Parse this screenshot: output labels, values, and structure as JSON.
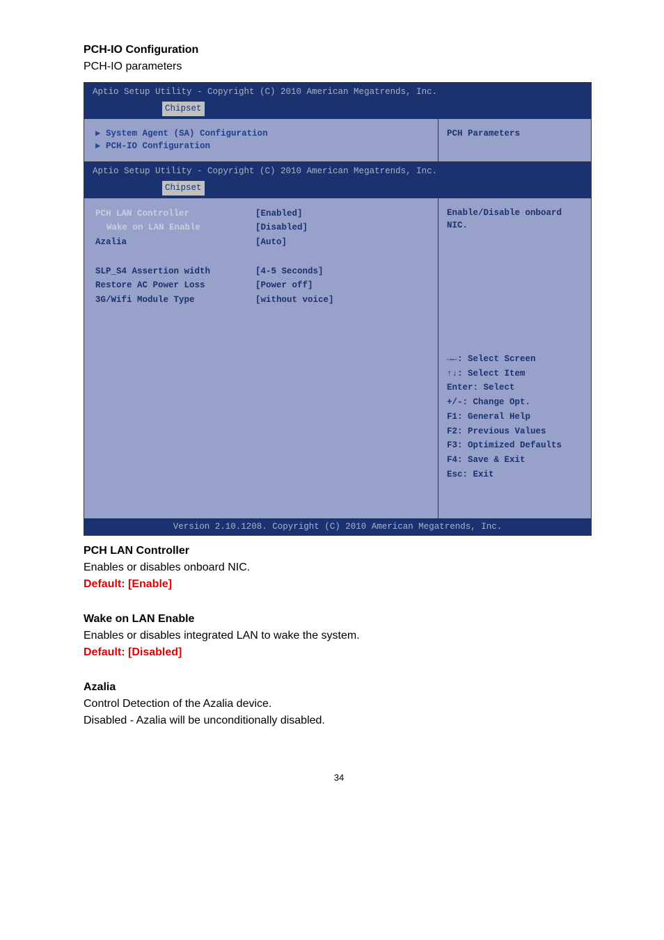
{
  "heading": "PCH-IO Configuration",
  "heading_sub": "PCH-IO parameters",
  "bios1": {
    "header_title": "Aptio Setup Utility - Copyright (C) 2010 American Megatrends, Inc.",
    "tab": "Chipset",
    "left_items": [
      "System Agent (SA) Configuration",
      "PCH-IO Configuration"
    ],
    "right_help": "PCH Parameters"
  },
  "bios2": {
    "header_title": "Aptio Setup Utility - Copyright (C) 2010 American Megatrends, Inc.",
    "tab": "Chipset",
    "settings": [
      {
        "label": "PCH LAN Controller",
        "value": "[Enabled]",
        "label_class": "label-white"
      },
      {
        "label": "Wake on LAN Enable",
        "value": "[Disabled]",
        "label_class": "label-white",
        "indent": true
      },
      {
        "label": "Azalia",
        "value": "[Auto]",
        "label_class": "label-blue"
      },
      {
        "label": "",
        "value": ""
      },
      {
        "label": "SLP_S4 Assertion width",
        "value": "[4-5 Seconds]",
        "label_class": "label-blue"
      },
      {
        "label": "Restore AC Power Loss",
        "value": "[Power off]",
        "label_class": "label-blue"
      },
      {
        "label": "3G/Wifi Module Type",
        "value": "[without voice]",
        "label_class": "label-blue"
      }
    ],
    "right_help_top": "Enable/Disable onboard NIC.",
    "right_help_bottom": [
      "→←: Select Screen",
      "↑↓: Select Item",
      "Enter: Select",
      "+/-: Change Opt.",
      "F1: General Help",
      "F2: Previous Values",
      "F3: Optimized Defaults",
      "F4: Save & Exit",
      "Esc: Exit"
    ],
    "footer": "Version 2.10.1208. Copyright (C) 2010 American Megatrends, Inc."
  },
  "sec1": {
    "title": "PCH LAN Controller",
    "desc": "Enables or disables onboard NIC.",
    "default": "Default: [Enable]"
  },
  "sec2": {
    "title": "Wake on LAN Enable",
    "desc": "Enables or disables integrated LAN to wake the system.",
    "default": "Default: [Disabled]"
  },
  "sec3": {
    "title": "Azalia",
    "desc1": "Control Detection of the Azalia device.",
    "desc2": "Disabled - Azalia will be unconditionally disabled."
  },
  "page_number": "34"
}
